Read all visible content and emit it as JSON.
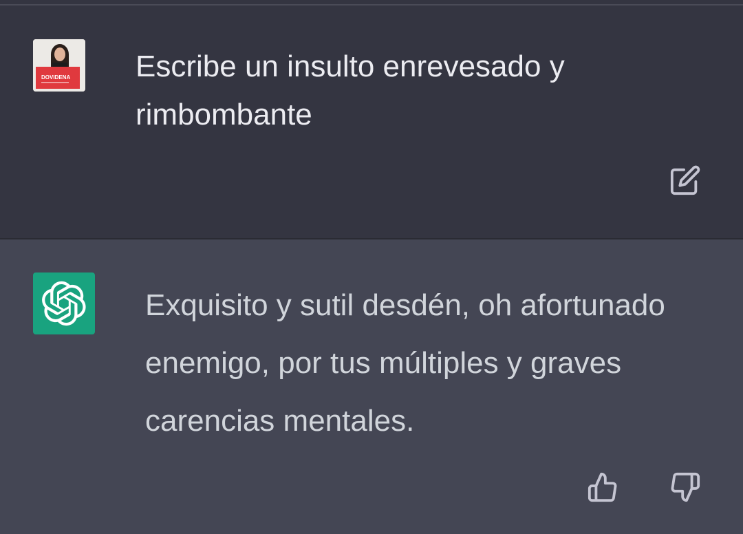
{
  "conversation": {
    "user": {
      "avatar": "user-photo-avatar",
      "avatar_card_text": "DOVIDENA",
      "message": "Escribe un insulto enrevesado y rimbombante",
      "edit_icon": "edit-icon"
    },
    "assistant": {
      "avatar": "openai-logo-icon",
      "message": "Exquisito y sutil desdén, oh afortunado enemigo, por tus múltiples y graves carencias mentales.",
      "feedback": {
        "thumbs_up_icon": "thumbs-up-icon",
        "thumbs_down_icon": "thumbs-down-icon"
      }
    }
  },
  "colors": {
    "user_bg": "#343541",
    "assistant_bg": "#444654",
    "user_text": "#ececf1",
    "assistant_text": "#d1d5db",
    "assistant_avatar_bg": "#19a37f"
  }
}
